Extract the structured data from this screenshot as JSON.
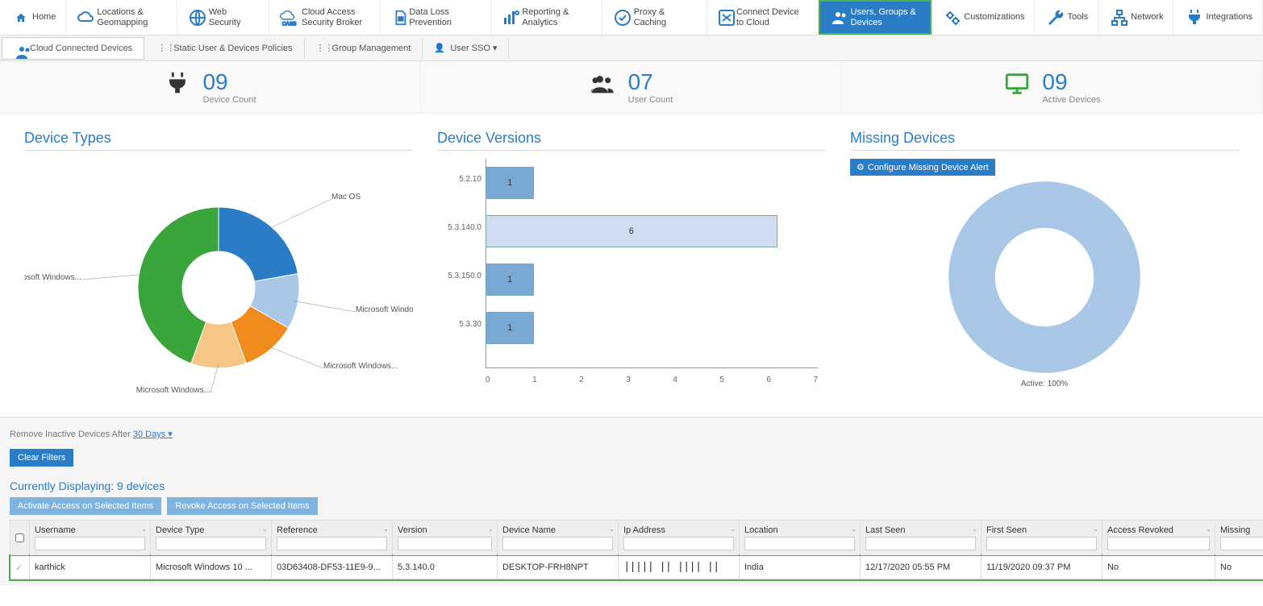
{
  "topnav": [
    {
      "label": "Home",
      "icon": "home"
    },
    {
      "label": "Locations & Geomapping",
      "icon": "cloud"
    },
    {
      "label": "Web Security",
      "icon": "globe"
    },
    {
      "label": "Cloud Access Security Broker",
      "icon": "casb"
    },
    {
      "label": "Data Loss Prevention",
      "icon": "doc"
    },
    {
      "label": "Reporting & Analytics",
      "icon": "bars"
    },
    {
      "label": "Proxy & Caching",
      "icon": "proxy"
    },
    {
      "label": "Connect Device to Cloud",
      "icon": "connect"
    },
    {
      "label": "Users, Groups & Devices",
      "icon": "users",
      "active": true
    },
    {
      "label": "Customizations",
      "icon": "gears"
    },
    {
      "label": "Tools",
      "icon": "wrench"
    },
    {
      "label": "Network",
      "icon": "net"
    },
    {
      "label": "Integrations",
      "icon": "plug"
    }
  ],
  "subnav": [
    {
      "label": "Cloud Connected Devices",
      "highlight": true
    },
    {
      "label": "Static User & Devices Policies"
    },
    {
      "label": "Group Management"
    },
    {
      "label": "User SSO",
      "dropdown": true
    }
  ],
  "stats": {
    "device_count": {
      "value": "09",
      "label": "Device Count"
    },
    "user_count": {
      "value": "07",
      "label": "User Count"
    },
    "active": {
      "value": "09",
      "label": "Active Devices"
    }
  },
  "panels": {
    "device_types": {
      "title": "Device Types"
    },
    "device_versions": {
      "title": "Device Versions"
    },
    "missing": {
      "title": "Missing Devices",
      "config_btn": "Configure Missing Device Alert",
      "ring_label": "Active: 100%"
    }
  },
  "chart_data": [
    {
      "type": "pie",
      "title": "Device Types",
      "series": [
        {
          "name": "Mac OS",
          "value": 2,
          "color": "#2b7cc7"
        },
        {
          "name": "Microsoft Windows...",
          "value": 1,
          "color": "#a9c8e8"
        },
        {
          "name": "Microsoft Windows...",
          "value": 1,
          "color": "#f08c1e"
        },
        {
          "name": "Microsoft Windows...",
          "value": 1,
          "color": "#f7c684"
        },
        {
          "name": "Microsoft Windows...",
          "value": 4,
          "color": "#3aa53a"
        }
      ]
    },
    {
      "type": "bar",
      "title": "Device Versions",
      "categories": [
        "5.2.10",
        "5.3.140.0",
        "5.3.150.0",
        "5.3.30"
      ],
      "values": [
        1,
        6,
        1,
        1
      ],
      "xlim": [
        0,
        7
      ]
    },
    {
      "type": "pie",
      "title": "Missing Devices",
      "series": [
        {
          "name": "Active",
          "value": 100,
          "color": "#a9c8e8"
        }
      ]
    }
  ],
  "lower": {
    "remove_label": "Remove Inactive Devices After ",
    "remove_value": "30 Days",
    "clear_filters": "Clear Filters",
    "currently": "Currently Displaying: 9 devices",
    "activate_btn": "Activate Access on Selected Items",
    "revoke_btn": "Revoke Access on Selected Items"
  },
  "table": {
    "columns": [
      "Username",
      "Device Type",
      "Reference",
      "Version",
      "Device Name",
      "Ip Address",
      "Location",
      "Last Seen",
      "First Seen",
      "Access Revoked",
      "Missing"
    ],
    "rows": [
      {
        "username": "karthick",
        "device_type": "Microsoft Windows 10 ...",
        "reference": "03D63408-DF53-11E9-9...",
        "version": "5.3.140.0",
        "device_name": "DESKTOP-FRH8NPT",
        "ip": "(barcode)",
        "location": "India",
        "last_seen": "12/17/2020 05:55 PM",
        "first_seen": "11/19/2020 09:37 PM",
        "revoked": "No",
        "missing": "No"
      }
    ]
  }
}
